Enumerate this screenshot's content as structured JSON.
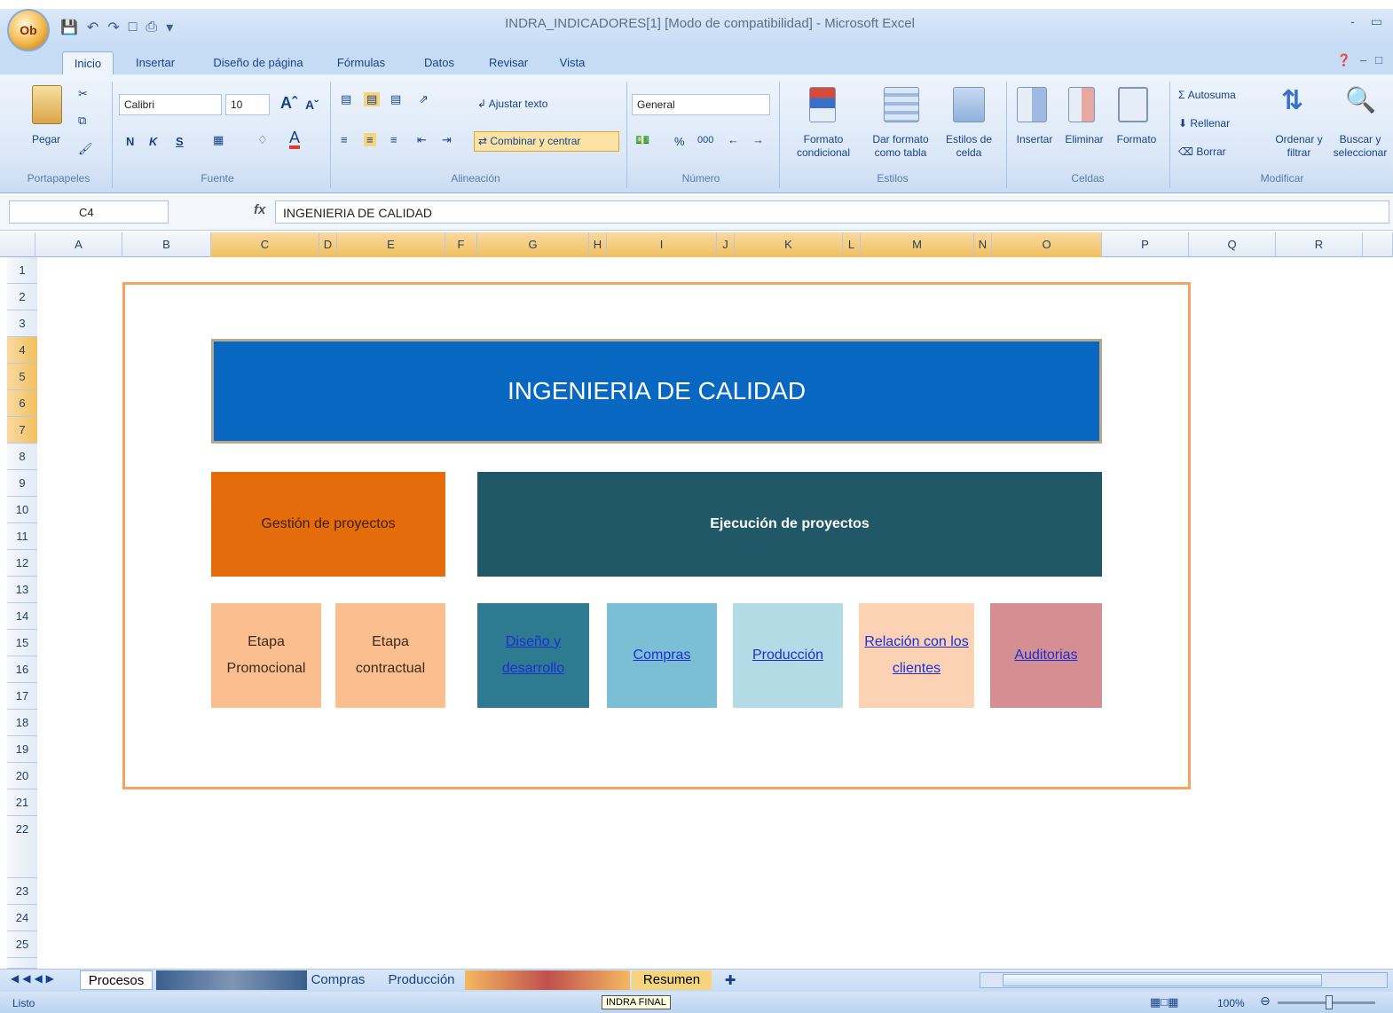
{
  "window": {
    "title": "INDRA_INDICADORES[1] [Modo de compatibilidad] - Microsoft Excel",
    "office_button": "Ob",
    "controls": [
      "-",
      "▭",
      "✕"
    ]
  },
  "ribbon_tabs": [
    "Inicio",
    "Insertar",
    "Diseño de página",
    "Fórmulas",
    "Datos",
    "Revisar",
    "Vista"
  ],
  "ribbon": {
    "portapapeles": {
      "paste": "Pegar",
      "label": "Portapapeles"
    },
    "fuente": {
      "font": "Calibri",
      "size": "10",
      "bold": "N",
      "italic": "K",
      "underline": "S",
      "label": "Fuente"
    },
    "alineacion": {
      "wrap": "Ajustar texto",
      "merge": "Combinar y centrar",
      "label": "Alineación"
    },
    "numero": {
      "format": "General",
      "percent": "%",
      "thousands": "000",
      "label": "Número"
    },
    "estilos": {
      "conditional": "Formato condicional",
      "as_table": "Dar formato como tabla",
      "cell_styles": "Estilos de celda",
      "label": "Estilos"
    },
    "celdas": {
      "insert": "Insertar",
      "delete": "Eliminar",
      "format": "Formato",
      "label": "Celdas"
    },
    "modificar": {
      "autosum": "Autosuma",
      "fill": "Rellenar",
      "clear": "Borrar",
      "sort": "Ordenar y filtrar",
      "find": "Buscar y seleccionar",
      "label": "Modificar"
    }
  },
  "formula_bar": {
    "cell_ref": "C4",
    "fx": "fx",
    "content": "INGENIERIA DE CALIDAD"
  },
  "columns": [
    "A",
    "B",
    "C",
    "D",
    "E",
    "F",
    "G",
    "H",
    "I",
    "J",
    "K",
    "L",
    "M",
    "N",
    "O",
    "P",
    "Q",
    "R"
  ],
  "rows": [
    "1",
    "2",
    "3",
    "4",
    "5",
    "6",
    "7",
    "8",
    "9",
    "10",
    "11",
    "12",
    "13",
    "14",
    "15",
    "16",
    "17",
    "18",
    "19",
    "20",
    "21",
    "22",
    "23",
    "24",
    "25"
  ],
  "diagram": {
    "title": "INGENIERIA DE CALIDAD",
    "left_section": "Gestión de proyectos",
    "right_section": "Ejecución de proyectos",
    "etapa_promocional": "Etapa Promocional",
    "etapa_contractual": "Etapa contractual",
    "diseno": "Diseño y desarrollo",
    "compras": "Compras",
    "produccion": "Producción",
    "relacion": "Relación con los clientes",
    "auditorias": "Auditorias"
  },
  "sheet_tabs": {
    "procesos": "Procesos",
    "compras": "Compras",
    "produccion": "Producción",
    "resumen": "Resumen"
  },
  "status": {
    "ready": "Listo",
    "tooltip": "INDRA FINAL",
    "zoom": "100%"
  }
}
